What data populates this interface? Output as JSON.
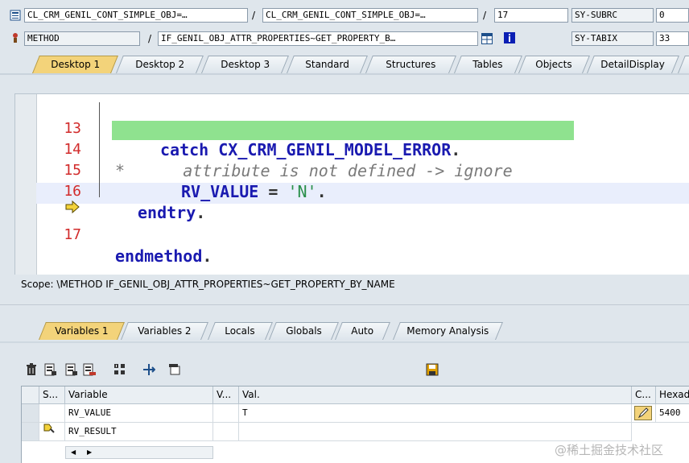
{
  "header": {
    "row1": {
      "field1": "CL_CRM_GENIL_CONT_SIMPLE_OBJ=…",
      "field2": "CL_CRM_GENIL_CONT_SIMPLE_OBJ=…",
      "line": "17",
      "sys_label": "SY-SUBRC",
      "sys_value": "0"
    },
    "row2": {
      "type": "METHOD",
      "method": "IF_GENIL_OBJ_ATTR_PROPERTIES~GET_PROPERTY_B…",
      "sys_label": "SY-TABIX",
      "sys_value": "33"
    },
    "separator": "/"
  },
  "desktop_tabs": [
    "Desktop 1",
    "Desktop 2",
    "Desktop 3",
    "Standard",
    "Structures",
    "Tables",
    "Objects",
    "DetailDisplay"
  ],
  "code": {
    "lines": [
      {
        "num": "13",
        "parts": [
          {
            "t": "catch ",
            "c": "kw"
          },
          {
            "t": "CX_CRM_GENIL_MODEL_ERROR",
            "c": "ex"
          },
          {
            "t": ".",
            "c": "pun"
          }
        ]
      },
      {
        "num": "14",
        "parts": [
          {
            "t": "*",
            "c": "cmt"
          },
          {
            "t": "    attribute is not defined -> ignore",
            "c": "cmt"
          }
        ]
      },
      {
        "num": "15",
        "parts": [
          {
            "t": "RV_VALUE",
            "c": "ex"
          },
          {
            "t": " = ",
            "c": "pun"
          },
          {
            "t": "'N'",
            "c": "str"
          },
          {
            "t": ".",
            "c": "pun"
          }
        ]
      },
      {
        "num": "16",
        "parts": [
          {
            "t": "endtry",
            "c": "kw"
          },
          {
            "t": ".",
            "c": "pun"
          }
        ]
      },
      {
        "num": "17",
        "parts": [
          {
            "t": "endmethod",
            "c": "kw"
          },
          {
            "t": ".",
            "c": "pun"
          }
        ]
      }
    ]
  },
  "scope": "Scope: \\METHOD IF_GENIL_OBJ_ATTR_PROPERTIES~GET_PROPERTY_BY_NAME",
  "var_tabs": [
    "Variables 1",
    "Variables 2",
    "Locals",
    "Globals",
    "Auto",
    "Memory Analysis"
  ],
  "table": {
    "headers": [
      "S...",
      "Variable",
      "V...",
      "Val.",
      "C...",
      "Hexadecimal"
    ],
    "rows": [
      {
        "variable": "RV_VALUE",
        "value": "T",
        "hex": "5400"
      },
      {
        "variable": "RV_RESULT",
        "value": "",
        "hex": ""
      }
    ]
  },
  "watermark": "@稀土掘金技术社区",
  "colors": {
    "active_tab": "#f3d37a",
    "comment_highlight": "#8fe28f",
    "line_number": "#d22b2b",
    "keyword": "#1a1ab0"
  }
}
